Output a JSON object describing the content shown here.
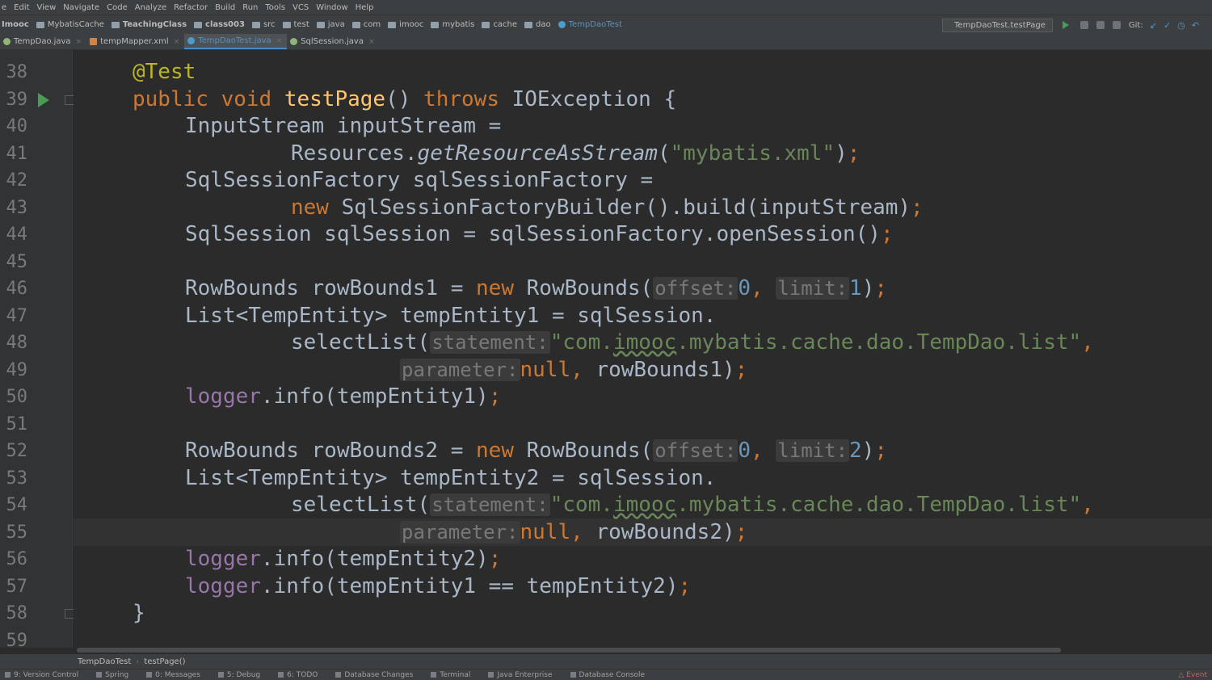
{
  "menu": [
    "e",
    "Edit",
    "View",
    "Navigate",
    "Code",
    "Analyze",
    "Refactor",
    "Build",
    "Run",
    "Tools",
    "VCS",
    "Window",
    "Help"
  ],
  "nav": {
    "crumbs": [
      "Imooc",
      "MybatisCache",
      "TeachingClass",
      "class003",
      "src",
      "test",
      "java",
      "com",
      "imooc",
      "mybatis",
      "cache",
      "dao",
      "TempDaoTest"
    ],
    "run_config": "TempDaoTest.testPage",
    "git_label": "Git:"
  },
  "tabs": [
    "TempDao.java",
    "tempMapper.xml",
    "TempDaoTest.java",
    "SqlSession.java"
  ],
  "line_numbers": [
    "38",
    "39",
    "40",
    "41",
    "42",
    "43",
    "44",
    "45",
    "46",
    "47",
    "48",
    "49",
    "50",
    "51",
    "52",
    "53",
    "54",
    "55",
    "56",
    "57",
    "58",
    "59"
  ],
  "code": {
    "l38_ann": "@Test",
    "l39_kw1": "public void ",
    "l39_fn": "testPage",
    "l39_mid": "() ",
    "l39_kw2": "throws ",
    "l39_rest": "IOException {",
    "l40": "InputStream inputStream =",
    "l41_pre": "Resources.",
    "l41_it": "getResourceAsStream",
    "l41_p": "(",
    "l41_str": "\"mybatis.xml\"",
    "l41_post": ")",
    "l42": "SqlSessionFactory sqlSessionFactory =",
    "l43_kw": "new ",
    "l43_rest": "SqlSessionFactoryBuilder().build(inputStream)",
    "l44": "SqlSession sqlSession = sqlSessionFactory.openSession()",
    "l46_pre": "RowBounds rowBounds1 = ",
    "l46_kw": "new ",
    "l46_cls": "RowBounds(",
    "hint_offset": "offset:",
    "hint_limit": "limit:",
    "l46_off": "0",
    "l46_lim": "1",
    "l47": "List<TempEntity> tempEntity1 = sqlSession.",
    "l48_pre": "selectList(",
    "hint_statement": "statement:",
    "stmt_a": "\"com.",
    "stmt_b": "imooc",
    "stmt_c": ".mybatis.cache.dao.TempDao.list\"",
    "hint_parameter": "parameter:",
    "null_kw": "null",
    "l49_post": "rowBounds1)",
    "logger": "logger",
    "l50_post": ".info(tempEntity1)",
    "l52_pre": "RowBounds rowBounds2 = ",
    "l52_off": "0",
    "l52_lim": "2",
    "l53": "List<TempEntity> tempEntity2 = sqlSession.",
    "l55_post": "rowBounds2)",
    "l56_post": ".info(tempEntity2)",
    "l57_post": ".info(tempEntity1 == tempEntity2)",
    "l58": "}"
  },
  "breadcrumb": [
    "TempDaoTest",
    "testPage()"
  ],
  "status": [
    "9: Version Control",
    "Spring",
    "0: Messages",
    "5: Debug",
    "6: TODO",
    "Database Changes",
    "Terminal",
    "Java Enterprise",
    "Database Console"
  ],
  "event": "Event"
}
